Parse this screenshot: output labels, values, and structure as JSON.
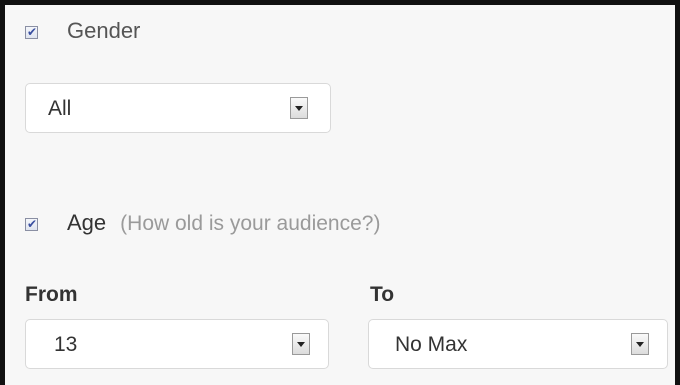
{
  "gender": {
    "label": "Gender",
    "checked": true,
    "select_value": "All"
  },
  "age": {
    "label": "Age",
    "hint": "(How old is your audience?)",
    "checked": true,
    "from_label": "From",
    "to_label": "To",
    "from_value": "13",
    "to_value": "No Max"
  },
  "icons": {
    "checkbox_mark": "✔"
  }
}
